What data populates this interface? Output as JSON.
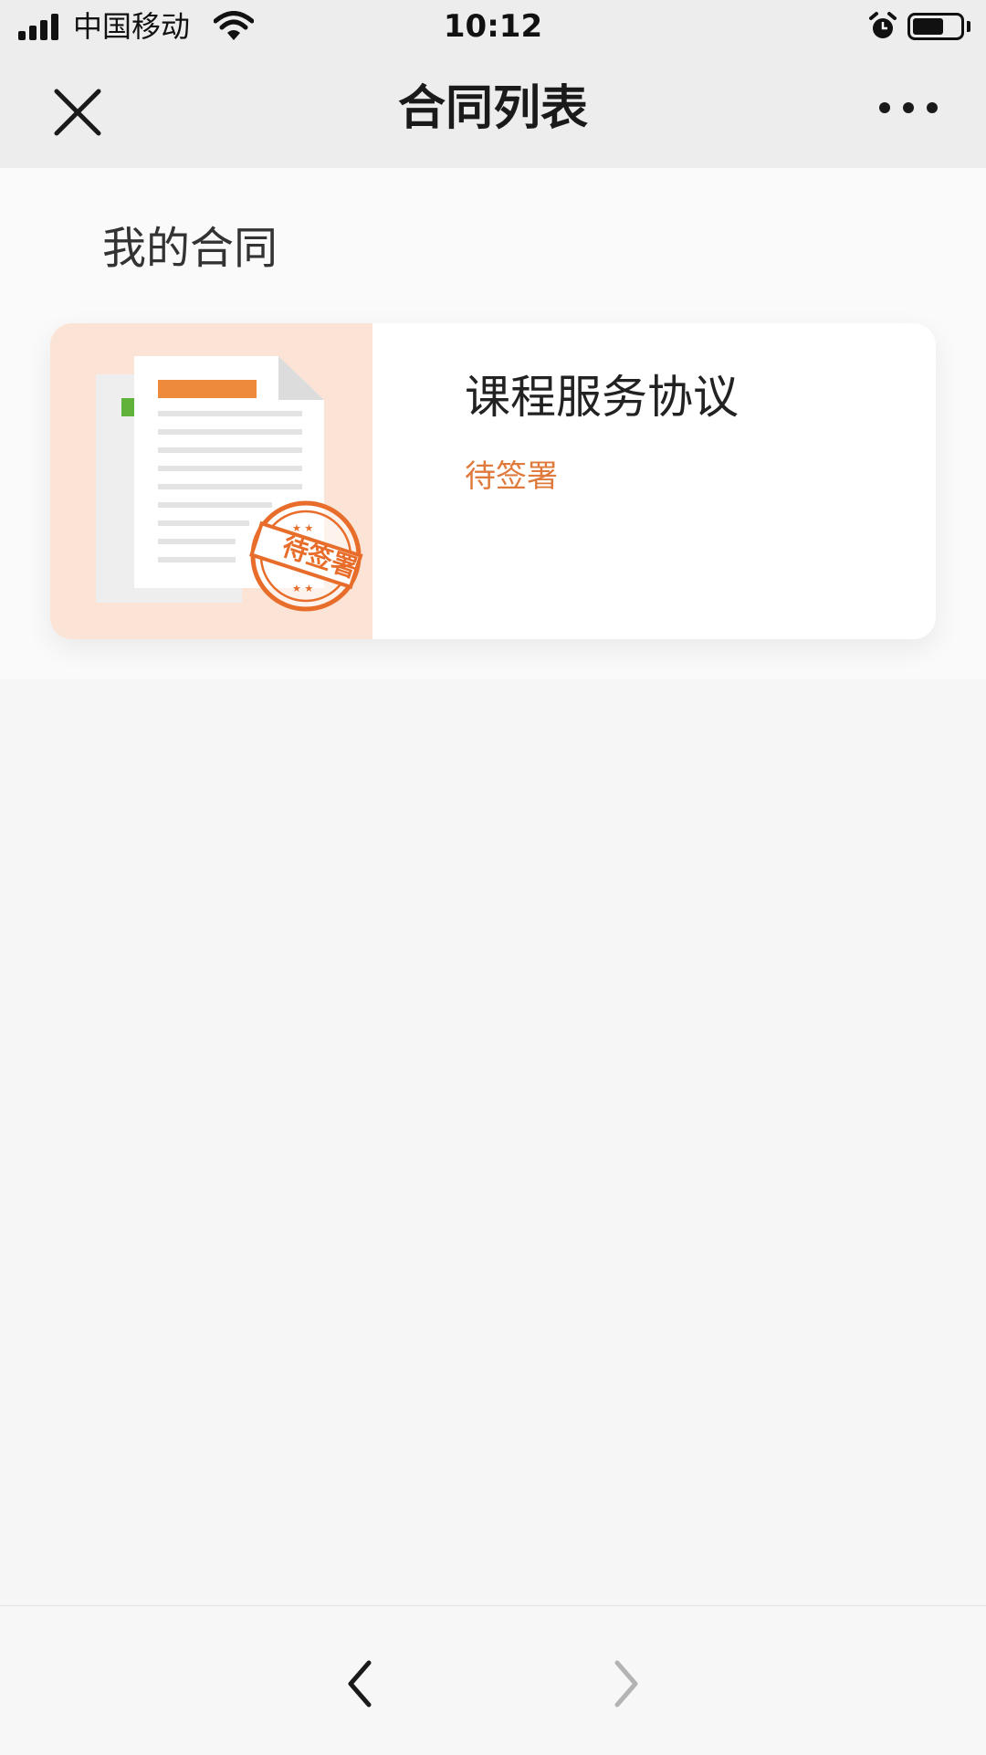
{
  "status_bar": {
    "carrier": "中国移动",
    "time": "10:12",
    "signal_bars": 4,
    "battery_level": 0.65,
    "icons": [
      "signal-icon",
      "wifi-icon",
      "alarm-icon",
      "battery-icon"
    ]
  },
  "nav": {
    "title": "合同列表",
    "close_icon": "close-icon",
    "more_icon": "more-icon"
  },
  "main": {
    "section_title": "我的合同",
    "contracts": [
      {
        "title": "课程服务协议",
        "status": "待签署",
        "status_color": "#e07a3c",
        "stamp_text": "待签署",
        "thumbnail_icon": "contract-document-icon"
      }
    ]
  },
  "toolbar": {
    "back_icon": "back-arrow-icon",
    "forward_icon": "forward-arrow-icon"
  },
  "colors": {
    "accent": "#e07a3c",
    "header_bg": "#ededed",
    "page_bg": "#f6f6f6",
    "thumb_bg": "#fbe3d5"
  }
}
